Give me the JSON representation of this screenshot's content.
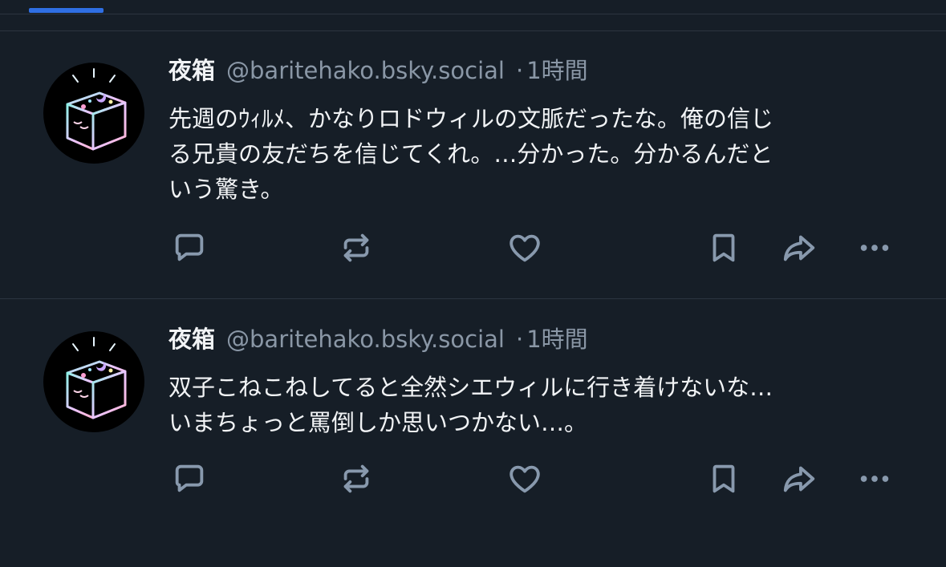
{
  "posts": [
    {
      "author": "夜箱",
      "handle": "@baritehako.bsky.social",
      "separator": "·",
      "time": "1時間",
      "text_lines": [
        "先週のｳｨﾙﾒ、かなりロドウィルの文脈だったな。俺の信じ",
        "る兄貴の友だちを信じてくれ。…分かった。分かるんだと",
        "いう驚き。"
      ]
    },
    {
      "author": "夜箱",
      "handle": "@baritehako.bsky.social",
      "separator": "·",
      "time": "1時間",
      "text_lines": [
        "双子こねこねしてると全然シエウィルに行き着けないな…",
        "いまちょっと罵倒しか思いつかない…。"
      ]
    }
  ],
  "icons": {
    "reply": "speech-bubble-icon",
    "repost": "repost-arrows-icon",
    "like": "heart-icon",
    "bookmark": "bookmark-icon",
    "share": "share-arrow-icon",
    "more": "ellipsis-icon"
  },
  "colors": {
    "background": "#161e27",
    "text": "#f1f3f5",
    "muted": "#8a97a6",
    "icon": "#8899ad",
    "accent": "#2f6fe4"
  }
}
